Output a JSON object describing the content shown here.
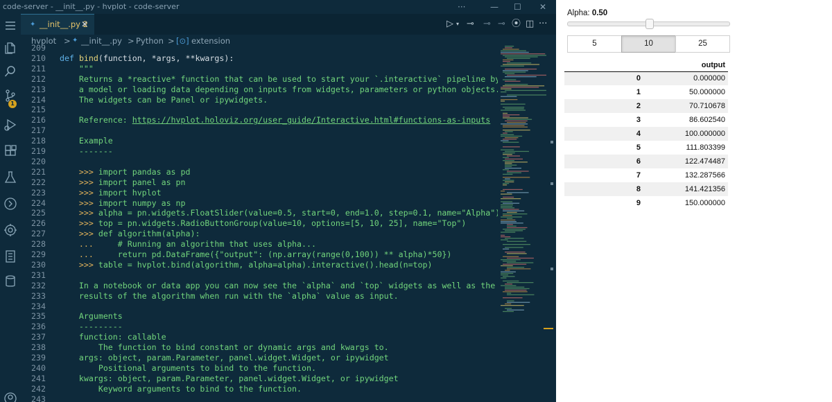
{
  "window": {
    "title": "code-server - __init__.py - hvplot - code-server"
  },
  "tab": {
    "filename": "__init__.py",
    "modified_count": "2",
    "close_glyph": "✕"
  },
  "breadcrumb": {
    "items": [
      "hvplot",
      "__init__.py",
      "Python",
      "extension"
    ],
    "separator": ">"
  },
  "activity_bar": {
    "items": [
      "menu-icon",
      "files-icon",
      "search-icon",
      "source-control-icon",
      "run-debug-icon",
      "extensions-icon",
      "testing-icon",
      "python-icon",
      "settings-extension-icon",
      "notebook-icon",
      "database-icon"
    ],
    "source_control_badge": "1"
  },
  "code": {
    "lines": [
      {
        "n": "209",
        "t": ""
      },
      {
        "n": "210",
        "t": "def bind(function, *args, **kwargs):"
      },
      {
        "n": "211",
        "t": "    \"\"\""
      },
      {
        "n": "212",
        "t": "    Returns a *reactive* function that can be used to start your `.interactive` pipeline by running"
      },
      {
        "n": "213",
        "t": "    a model or loading data depending on inputs from widgets, parameters or python objects."
      },
      {
        "n": "214",
        "t": "    The widgets can be Panel or ipywidgets."
      },
      {
        "n": "215",
        "t": ""
      },
      {
        "n": "216",
        "t": "    Reference: https://hvplot.holoviz.org/user_guide/Interactive.html#functions-as-inputs"
      },
      {
        "n": "217",
        "t": ""
      },
      {
        "n": "218",
        "t": "    Example"
      },
      {
        "n": "219",
        "t": "    -------"
      },
      {
        "n": "220",
        "t": ""
      },
      {
        "n": "221",
        "t": "    >>> import pandas as pd"
      },
      {
        "n": "222",
        "t": "    >>> import panel as pn"
      },
      {
        "n": "223",
        "t": "    >>> import hvplot"
      },
      {
        "n": "224",
        "t": "    >>> import numpy as np"
      },
      {
        "n": "225",
        "t": "    >>> alpha = pn.widgets.FloatSlider(value=0.5, start=0, end=1.0, step=0.1, name=\"Alpha\")"
      },
      {
        "n": "226",
        "t": "    >>> top = pn.widgets.RadioButtonGroup(value=10, options=[5, 10, 25], name=\"Top\")"
      },
      {
        "n": "227",
        "t": "    >>> def algorithm(alpha):"
      },
      {
        "n": "228",
        "t": "    ...     # Running an algorithm that uses alpha..."
      },
      {
        "n": "229",
        "t": "    ...     return pd.DataFrame({\"output\": (np.array(range(0,100)) ** alpha)*50})"
      },
      {
        "n": "230",
        "t": "    >>> table = hvplot.bind(algorithm, alpha=alpha).interactive().head(n=top)"
      },
      {
        "n": "231",
        "t": ""
      },
      {
        "n": "232",
        "t": "    In a notebook or data app you can now see the `alpha` and `top` widgets as well as the `top`"
      },
      {
        "n": "233",
        "t": "    results of the algorithm when run with the `alpha` value as input."
      },
      {
        "n": "234",
        "t": ""
      },
      {
        "n": "235",
        "t": "    Arguments"
      },
      {
        "n": "236",
        "t": "    ---------"
      },
      {
        "n": "237",
        "t": "    function: callable"
      },
      {
        "n": "238",
        "t": "        The function to bind constant or dynamic args and kwargs to."
      },
      {
        "n": "239",
        "t": "    args: object, param.Parameter, panel.widget.Widget, or ipywidget"
      },
      {
        "n": "240",
        "t": "        Positional arguments to bind to the function."
      },
      {
        "n": "241",
        "t": "    kwargs: object, param.Parameter, panel.widget.Widget, or ipywidget"
      },
      {
        "n": "242",
        "t": "        Keyword arguments to bind to the function."
      },
      {
        "n": "243",
        "t": ""
      }
    ]
  },
  "panel": {
    "slider": {
      "label": "Alpha:",
      "value_text": "0.50",
      "value": 0.5,
      "start": 0,
      "end": 1
    },
    "radio": {
      "options": [
        "5",
        "10",
        "25"
      ],
      "selected": "10"
    },
    "table": {
      "columns": [
        "",
        "output"
      ],
      "rows": [
        [
          "0",
          "0.000000"
        ],
        [
          "1",
          "50.000000"
        ],
        [
          "2",
          "70.710678"
        ],
        [
          "3",
          "86.602540"
        ],
        [
          "4",
          "100.000000"
        ],
        [
          "5",
          "111.803399"
        ],
        [
          "6",
          "122.474487"
        ],
        [
          "7",
          "132.287566"
        ],
        [
          "8",
          "141.421356"
        ],
        [
          "9",
          "150.000000"
        ]
      ]
    }
  },
  "colors": {
    "editor_background": "#0e2a3b",
    "docstring": "#72d57c",
    "keyword": "#5fb0e6",
    "function_name": "#e6d37a",
    "prompt": "#e4b45a",
    "line_number": "#7d93a3",
    "modified_tab": "#e6c46a",
    "badge": "#d6a21e"
  }
}
